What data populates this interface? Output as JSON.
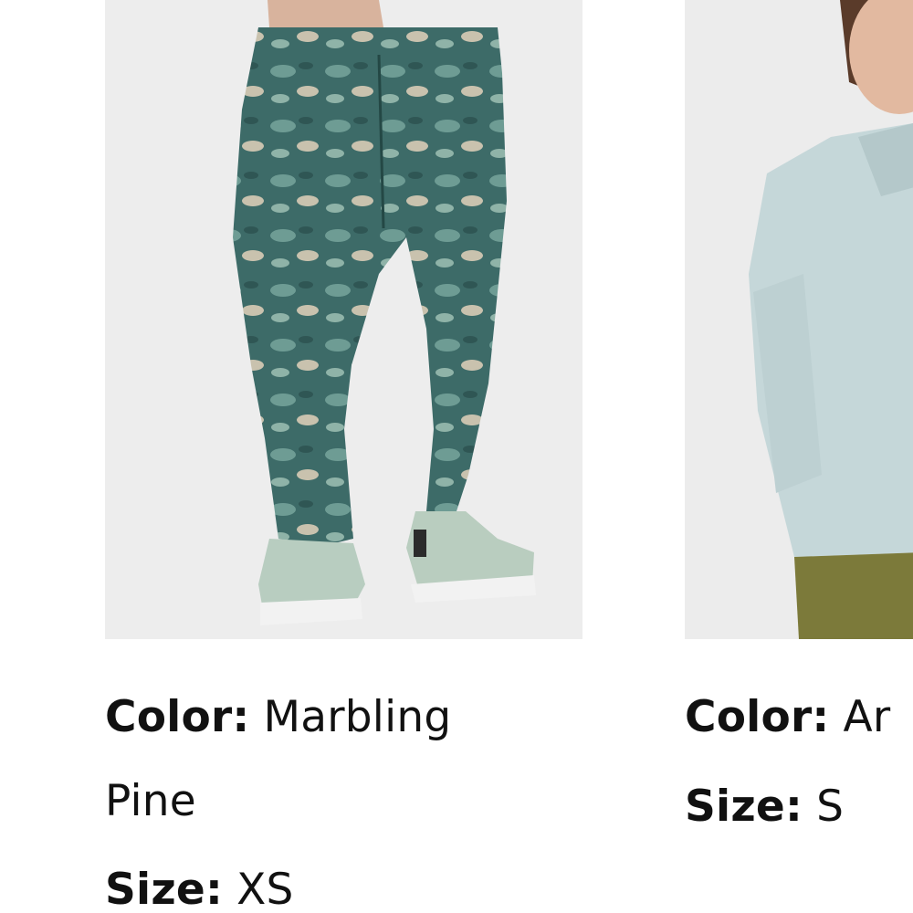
{
  "products": [
    {
      "image_alt": "Marbling print leggings with sneakers",
      "color_label": "Color:",
      "color_value": "Marbling Pine",
      "size_label": "Size:",
      "size_value": "XS"
    },
    {
      "image_alt": "Light blue hooded sweatshirt with olive leggings",
      "color_label": "Color:",
      "color_value": "Ar",
      "size_label": "Size:",
      "size_value": "S"
    }
  ],
  "colors": {
    "photo_bg": "#ededed",
    "legging_teal": "#3f6e6b",
    "hoodie_blue": "#c4d6d8",
    "olive": "#7c7a3a"
  }
}
